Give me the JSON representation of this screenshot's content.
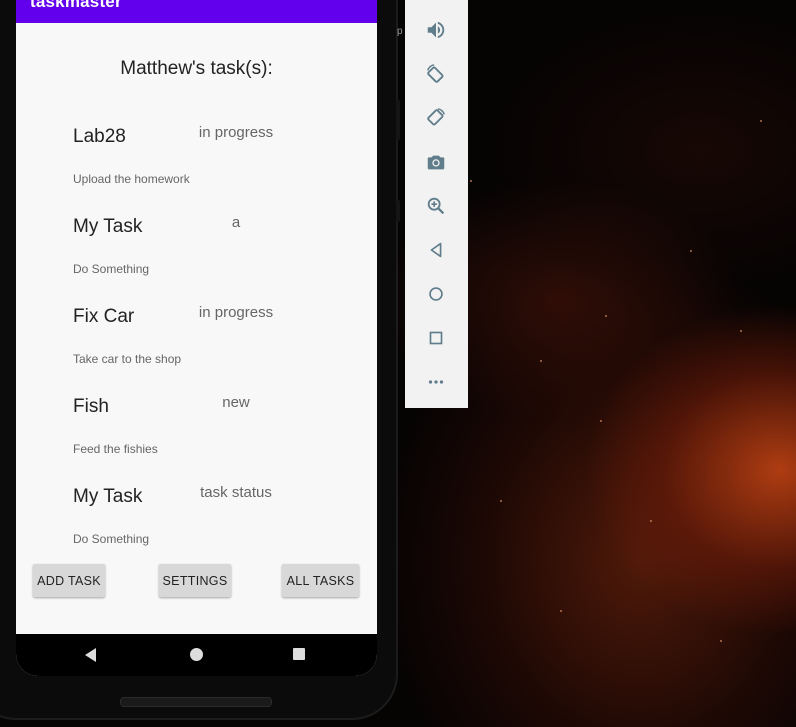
{
  "app": {
    "title": "taskmaster"
  },
  "page": {
    "title": "Matthew's task(s):"
  },
  "tasks": [
    {
      "title": "Lab28",
      "status": "in progress",
      "body": "Upload the homework"
    },
    {
      "title": "My Task",
      "status": "a",
      "body": "Do Something"
    },
    {
      "title": "Fix Car",
      "status": "in progress",
      "body": "Take car to the shop"
    },
    {
      "title": "Fish",
      "status": "new",
      "body": "Feed the fishies"
    },
    {
      "title": "My Task",
      "status": "task status",
      "body": "Do Something"
    }
  ],
  "buttons": {
    "add_task": "ADD TASK",
    "settings": "SETTINGS",
    "all_tasks": "ALL TASKS"
  },
  "nav": {
    "back": "back-icon",
    "home": "home-icon",
    "recents": "recents-icon"
  },
  "emulator_toolbar": [
    "volume-icon",
    "rotate-left-icon",
    "rotate-right-icon",
    "camera-icon",
    "zoom-icon",
    "back-icon",
    "home-icon",
    "overview-icon",
    "more-icon"
  ],
  "colors": {
    "app_bar": "#6200ee",
    "button": "#d8d8d8",
    "screen_bg": "#f8f8f8"
  }
}
